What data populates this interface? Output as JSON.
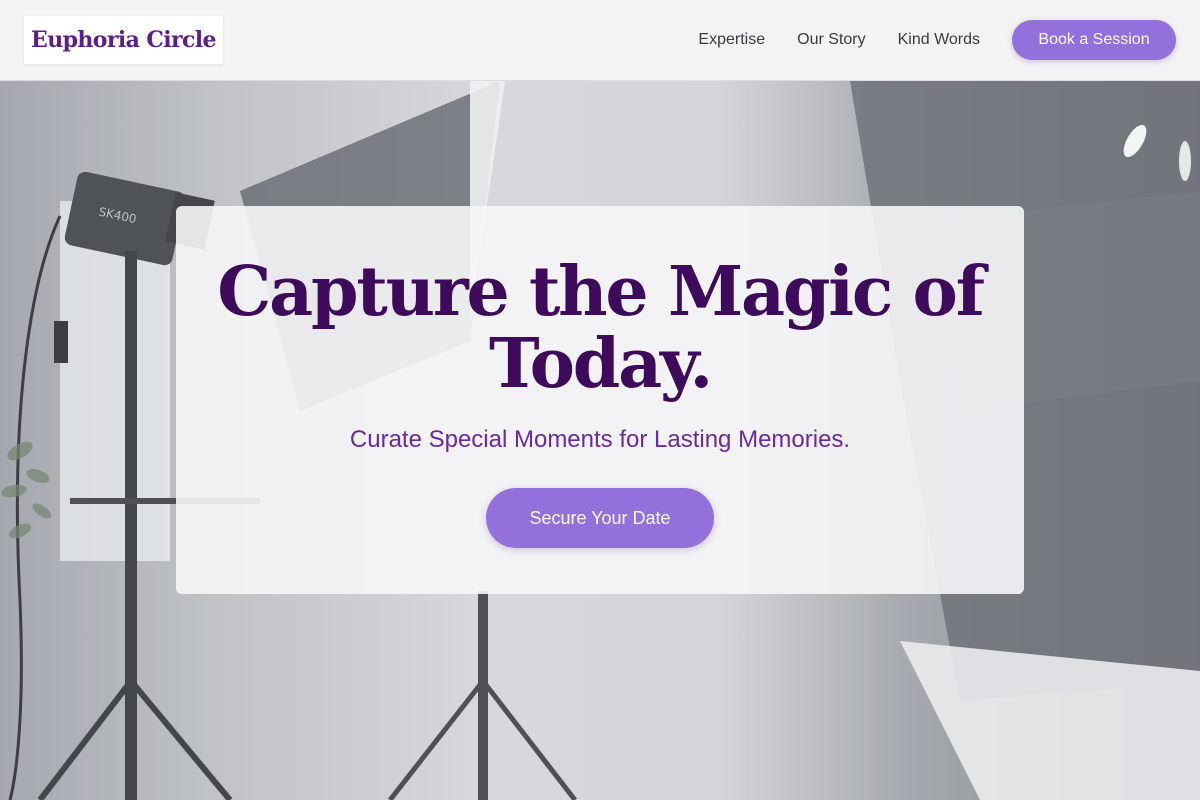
{
  "brand": {
    "name": "Euphoria Circle"
  },
  "nav": {
    "links": [
      "Expertise",
      "Our Story",
      "Kind Words"
    ],
    "cta_label": "Book a Session"
  },
  "hero": {
    "headline_line1": "Capture the Magic of",
    "headline_line2": "Today.",
    "subheadline": "Curate Special Moments for Lasting Memories.",
    "cta_label": "Secure Your Date",
    "background_image": "photo-studio-lighting-equipment"
  },
  "colors": {
    "accent": "#9370db",
    "headline": "#3d0a5c",
    "subheadline": "#6a2a9c",
    "header_bg": "#f3f3f4"
  }
}
